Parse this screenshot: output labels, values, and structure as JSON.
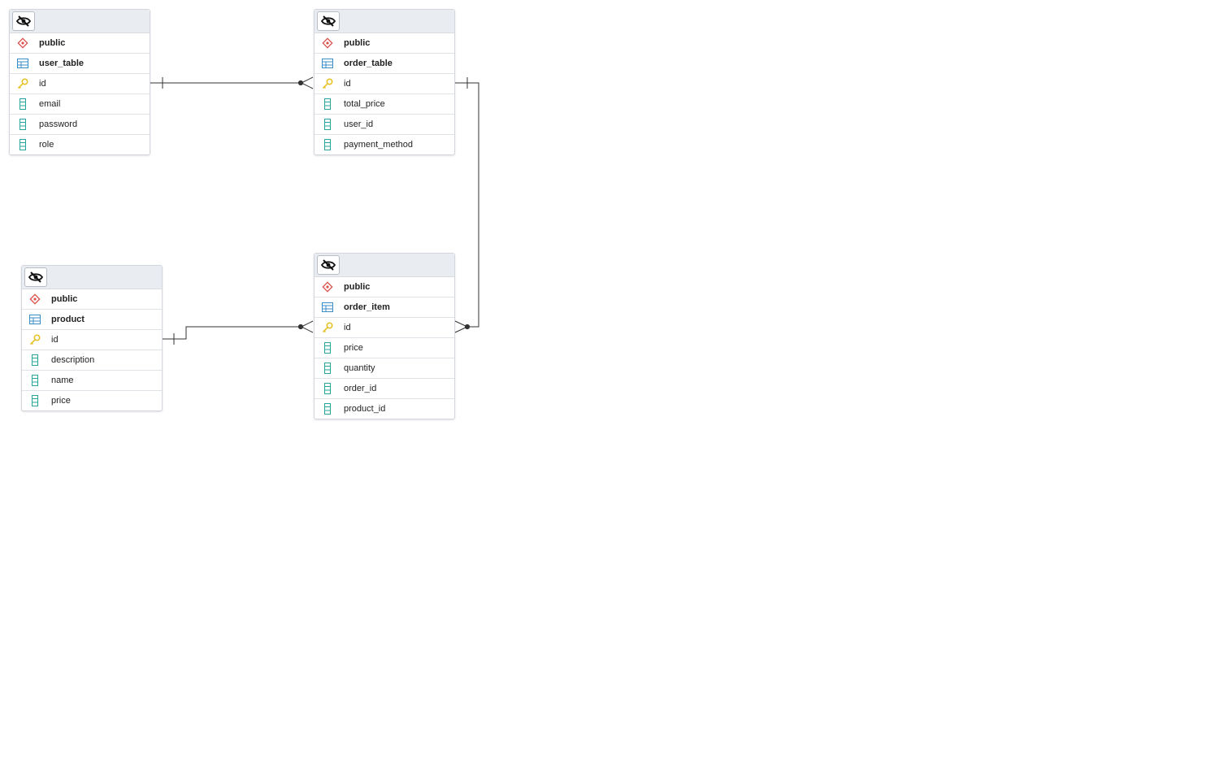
{
  "diagram": {
    "entities": [
      {
        "id": "user_table",
        "schema": "public",
        "table": "user_table",
        "columns": [
          {
            "name": "id",
            "icon": "key-icon"
          },
          {
            "name": "email",
            "icon": "column-icon"
          },
          {
            "name": "password",
            "icon": "column-icon"
          },
          {
            "name": "role",
            "icon": "column-icon"
          }
        ]
      },
      {
        "id": "order_table",
        "schema": "public",
        "table": "order_table",
        "columns": [
          {
            "name": "id",
            "icon": "key-icon"
          },
          {
            "name": "total_price",
            "icon": "column-icon"
          },
          {
            "name": "user_id",
            "icon": "column-icon"
          },
          {
            "name": "payment_method",
            "icon": "column-icon"
          }
        ]
      },
      {
        "id": "product",
        "schema": "public",
        "table": "product",
        "columns": [
          {
            "name": "id",
            "icon": "key-icon"
          },
          {
            "name": "description",
            "icon": "column-icon"
          },
          {
            "name": "name",
            "icon": "column-icon"
          },
          {
            "name": "price",
            "icon": "column-icon"
          }
        ]
      },
      {
        "id": "order_item",
        "schema": "public",
        "table": "order_item",
        "columns": [
          {
            "name": "id",
            "icon": "key-icon"
          },
          {
            "name": "price",
            "icon": "column-icon"
          },
          {
            "name": "quantity",
            "icon": "column-icon"
          },
          {
            "name": "order_id",
            "icon": "column-icon"
          },
          {
            "name": "product_id",
            "icon": "column-icon"
          }
        ]
      }
    ],
    "relationships": [
      {
        "from": "user_table",
        "to": "order_table",
        "from_cardinality": "one",
        "to_cardinality": "many"
      },
      {
        "from": "order_table",
        "to": "order_item",
        "from_cardinality": "one",
        "to_cardinality": "many"
      },
      {
        "from": "product",
        "to": "order_item",
        "from_cardinality": "one",
        "to_cardinality": "many"
      }
    ],
    "colors": {
      "schema_icon": "#d9534f",
      "table_icon": "#3a8ec8",
      "key_icon": "#e6c229",
      "column_icon": "#26a69a",
      "link": "#333333",
      "header_bg": "#e9ecf0"
    }
  }
}
